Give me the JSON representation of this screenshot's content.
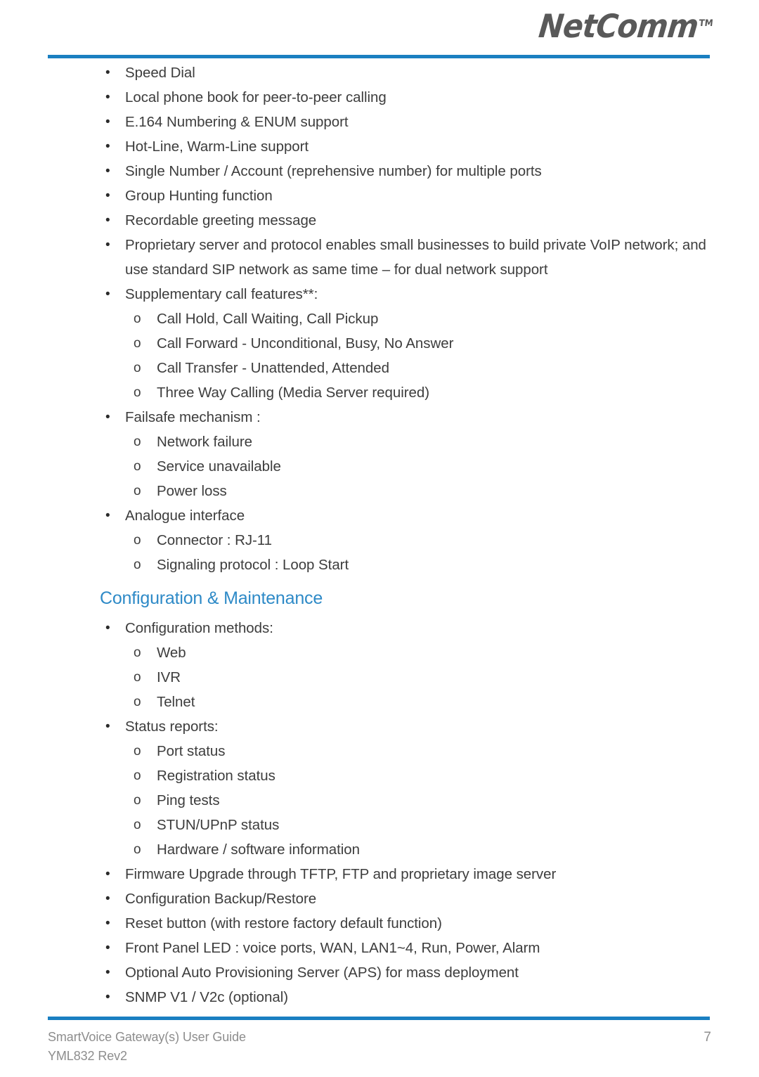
{
  "header": {
    "logo_text": "NetComm",
    "logo_tm": "TM",
    "rule_color": "#1a7fc1"
  },
  "content": {
    "blocks": [
      {
        "level": 1,
        "text": "Speed Dial"
      },
      {
        "level": 1,
        "text": "Local phone book for peer-to-peer calling"
      },
      {
        "level": 1,
        "text": "E.164 Numbering & ENUM support"
      },
      {
        "level": 1,
        "text": "Hot-Line, Warm-Line support"
      },
      {
        "level": 1,
        "text": "Single Number / Account (reprehensive number) for multiple ports"
      },
      {
        "level": 1,
        "text": "Group Hunting function"
      },
      {
        "level": 1,
        "text": "Recordable greeting message"
      },
      {
        "level": 1,
        "text": "Proprietary server and protocol enables small businesses to build private VoIP network; and use standard SIP network as same time – for dual network support"
      },
      {
        "level": 1,
        "text": "Supplementary call features**:"
      },
      {
        "level": 2,
        "text": "Call Hold, Call Waiting, Call Pickup"
      },
      {
        "level": 2,
        "text": "Call Forward - Unconditional, Busy, No Answer"
      },
      {
        "level": 2,
        "text": "Call Transfer - Unattended, Attended"
      },
      {
        "level": 2,
        "text": "Three Way Calling (Media Server required)"
      },
      {
        "level": 1,
        "text": "Failsafe mechanism :"
      },
      {
        "level": 2,
        "text": "Network failure"
      },
      {
        "level": 2,
        "text": "Service unavailable"
      },
      {
        "level": 2,
        "text": "Power loss"
      },
      {
        "level": 1,
        "text": "Analogue interface"
      },
      {
        "level": 2,
        "text": "Connector : RJ-11"
      },
      {
        "level": 2,
        "text": "Signaling protocol : Loop Start"
      }
    ],
    "heading": "Configuration & Maintenance",
    "heading_color": "#2e8ac7",
    "blocks_after_heading": [
      {
        "level": 1,
        "text": "Configuration methods:"
      },
      {
        "level": 2,
        "text": "Web"
      },
      {
        "level": 2,
        "text": "IVR"
      },
      {
        "level": 2,
        "text": "Telnet"
      },
      {
        "level": 1,
        "text": "Status reports:"
      },
      {
        "level": 2,
        "text": "Port status"
      },
      {
        "level": 2,
        "text": "Registration status"
      },
      {
        "level": 2,
        "text": "Ping tests"
      },
      {
        "level": 2,
        "text": "STUN/UPnP status"
      },
      {
        "level": 2,
        "text": "Hardware / software information"
      },
      {
        "level": 1,
        "text": "Firmware Upgrade through TFTP, FTP and proprietary image server"
      },
      {
        "level": 1,
        "text": "Configuration Backup/Restore"
      },
      {
        "level": 1,
        "text": "Reset button (with restore factory default function)"
      },
      {
        "level": 1,
        "text": "Front Panel LED : voice ports, WAN, LAN1~4, Run, Power, Alarm"
      },
      {
        "level": 1,
        "text": "Optional Auto Provisioning Server (APS) for mass deployment"
      },
      {
        "level": 1,
        "text": "SNMP V1 / V2c (optional)"
      }
    ],
    "bullet_marker": "•",
    "sub_marker": "o"
  },
  "footer": {
    "doc_title": "SmartVoice Gateway(s) User Guide",
    "doc_revision": "YML832 Rev2",
    "page_number": "7"
  }
}
